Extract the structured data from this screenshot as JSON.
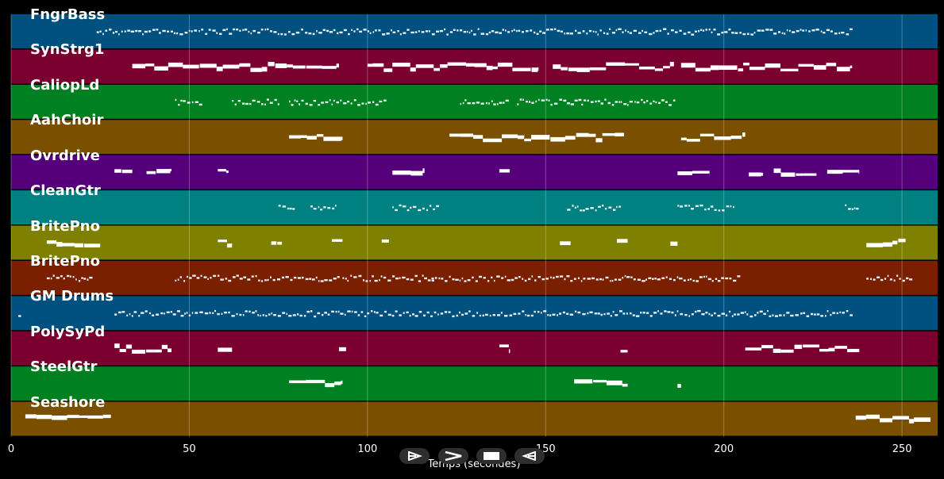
{
  "tracks": [
    {
      "name": "FngrBass",
      "color": "#005080",
      "notes": [
        [
          24,
          236
        ]
      ],
      "style": "dotted"
    },
    {
      "name": "SynStrg1",
      "color": "#7a0030",
      "notes": [
        [
          34,
          92
        ],
        [
          100,
          148
        ],
        [
          152,
          186
        ],
        [
          188,
          236
        ]
      ],
      "style": "block"
    },
    {
      "name": "CaliopLd",
      "color": "#008020",
      "notes": [
        [
          46,
          53
        ],
        [
          62,
          75
        ],
        [
          78,
          105
        ],
        [
          126,
          139
        ],
        [
          142,
          160
        ],
        [
          160,
          186
        ]
      ],
      "style": "dotted"
    },
    {
      "name": "AahChoir",
      "color": "#7a5000",
      "notes": [
        [
          78,
          93
        ],
        [
          123,
          144
        ],
        [
          144,
          172
        ],
        [
          188,
          206
        ]
      ],
      "style": "block"
    },
    {
      "name": "Ovrdrive",
      "color": "#55007a",
      "notes": [
        [
          29,
          34
        ],
        [
          38,
          45
        ],
        [
          58,
          61
        ],
        [
          107,
          116
        ],
        [
          137,
          140
        ],
        [
          187,
          196
        ],
        [
          207,
          211
        ],
        [
          214,
          226
        ],
        [
          229,
          238
        ]
      ],
      "style": "block"
    },
    {
      "name": "CleanGtr",
      "color": "#008080",
      "notes": [
        [
          75,
          79
        ],
        [
          84,
          91
        ],
        [
          107,
          120
        ],
        [
          156,
          171
        ],
        [
          187,
          203
        ],
        [
          234,
          238
        ]
      ],
      "style": "dotted"
    },
    {
      "name": "BritePno",
      "color": "#808000",
      "notes": [
        [
          10,
          25
        ],
        [
          58,
          62
        ],
        [
          73,
          76
        ],
        [
          90,
          93
        ],
        [
          104,
          106
        ],
        [
          154,
          157
        ],
        [
          170,
          173
        ],
        [
          185,
          187
        ],
        [
          240,
          251
        ]
      ],
      "style": "block"
    },
    {
      "name": "BritePno",
      "color": "#7a2000",
      "notes": [
        [
          10,
          23
        ],
        [
          46,
          92
        ],
        [
          93,
          118
        ],
        [
          118,
          178
        ],
        [
          178,
          205
        ],
        [
          240,
          252
        ]
      ],
      "style": "dotted"
    },
    {
      "name": "GM Drums",
      "color": "#005080",
      "notes": [
        [
          2,
          3
        ],
        [
          29,
          236
        ]
      ],
      "style": "dotted"
    },
    {
      "name": "PolySyPd",
      "color": "#7a0030",
      "notes": [
        [
          29,
          45
        ],
        [
          58,
          62
        ],
        [
          92,
          94
        ],
        [
          137,
          140
        ],
        [
          171,
          173
        ],
        [
          206,
          238
        ]
      ],
      "style": "block"
    },
    {
      "name": "SteelGtr",
      "color": "#008020",
      "notes": [
        [
          78,
          93
        ],
        [
          158,
          173
        ],
        [
          187,
          188
        ]
      ],
      "style": "block"
    },
    {
      "name": "Seashore",
      "color": "#7a5000",
      "notes": [
        [
          4,
          28
        ],
        [
          237,
          258
        ]
      ],
      "style": "block"
    }
  ],
  "chart_data": {
    "type": "piano-roll",
    "xlabel": "Temps (secondes)",
    "x_ticks": [
      "0",
      "50",
      "100",
      "150",
      "200",
      "250"
    ],
    "x_tick_values": [
      0,
      50,
      100,
      150,
      200,
      250
    ],
    "xlim": [
      0,
      260
    ],
    "grid": true
  },
  "controls": [
    {
      "name": "rewind-button",
      "icon": "rewind-icon"
    },
    {
      "name": "play-button",
      "icon": "play-icon"
    },
    {
      "name": "stop-button",
      "icon": "stop-icon"
    },
    {
      "name": "back-button",
      "icon": "back-icon"
    }
  ]
}
